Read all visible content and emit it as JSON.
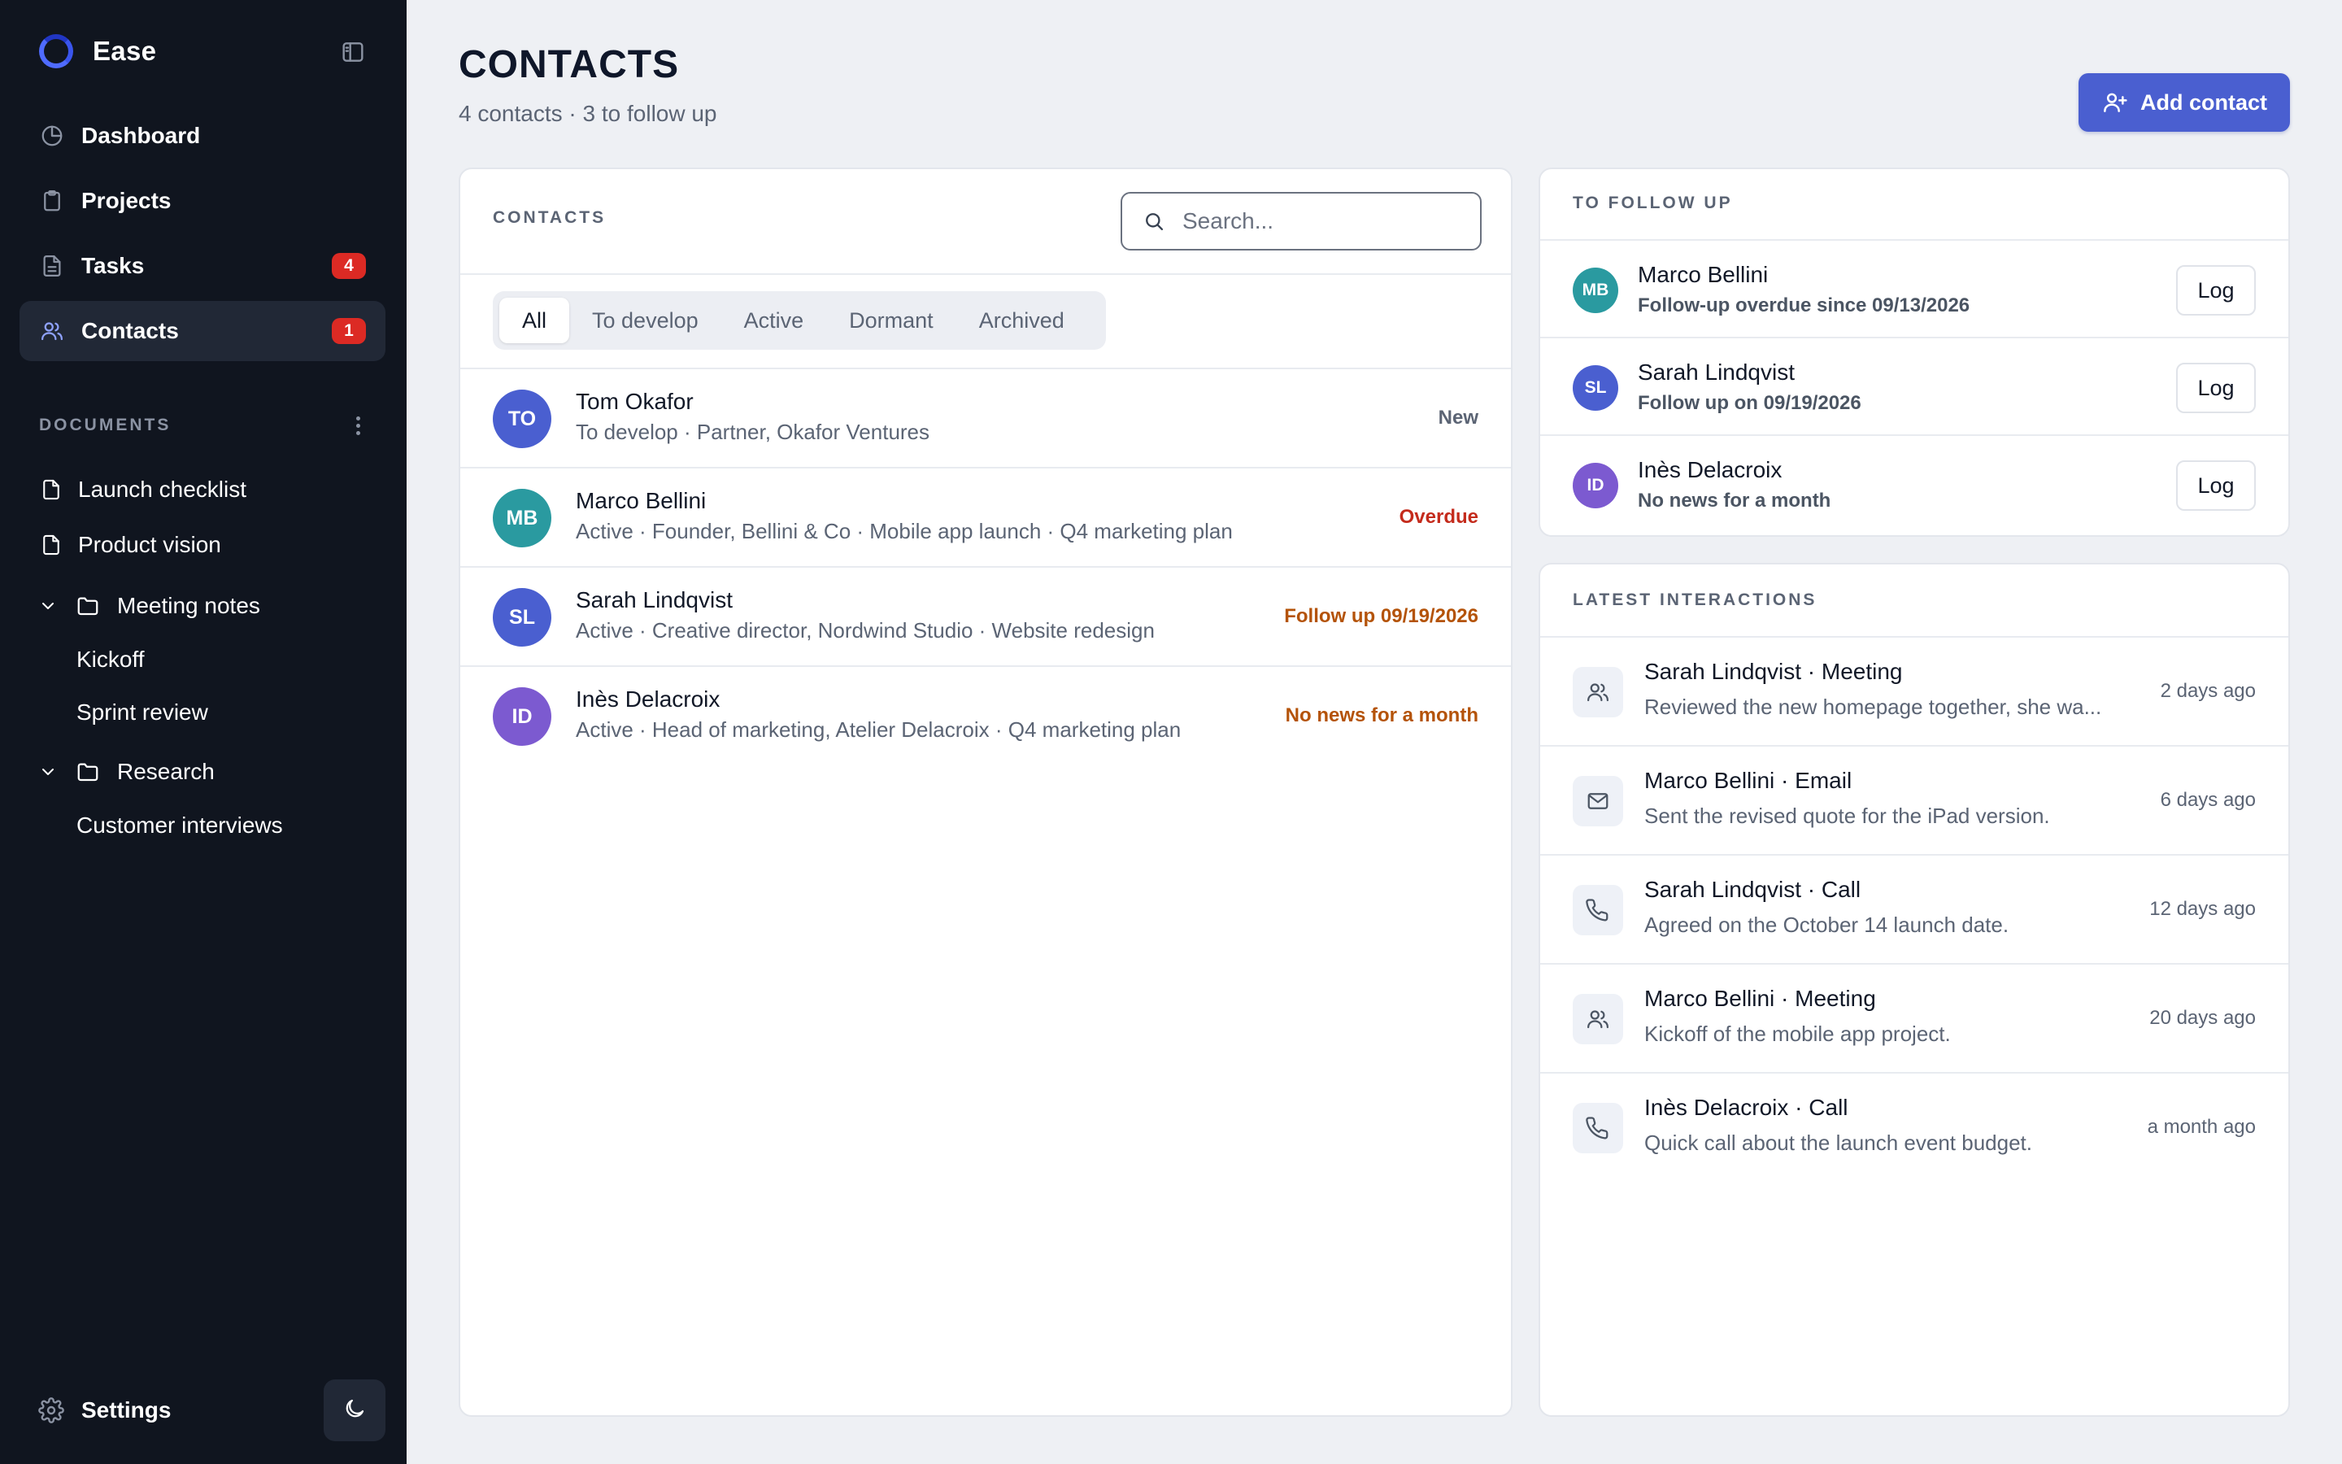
{
  "app": {
    "name": "Ease"
  },
  "colors": {
    "sidebar_bg": "#10151f",
    "accent": "#4a5fd0",
    "badge_red": "#dc2a24",
    "overdue": "#c42b1c",
    "warning": "#b45309"
  },
  "sidebar": {
    "nav": [
      {
        "label": "Dashboard",
        "icon": "pie-chart-icon"
      },
      {
        "label": "Projects",
        "icon": "clipboard-icon"
      },
      {
        "label": "Tasks",
        "icon": "file-text-icon",
        "badge": "4"
      },
      {
        "label": "Contacts",
        "icon": "users-icon",
        "badge": "1",
        "active": true
      }
    ],
    "documents_header": "DOCUMENTS",
    "documents": [
      {
        "label": "Launch checklist",
        "icon": "file-icon"
      },
      {
        "label": "Product vision",
        "icon": "file-icon"
      }
    ],
    "folders": [
      {
        "label": "Meeting notes",
        "children": [
          "Kickoff",
          "Sprint review"
        ]
      },
      {
        "label": "Research",
        "children": [
          "Customer interviews"
        ]
      }
    ],
    "settings_label": "Settings"
  },
  "header": {
    "title": "CONTACTS",
    "subtitle": "4 contacts · 3 to follow up",
    "add_button_label": "Add contact"
  },
  "contacts_panel": {
    "label": "CONTACTS",
    "search_placeholder": "Search...",
    "tabs": [
      "All",
      "To develop",
      "Active",
      "Dormant",
      "Archived"
    ],
    "active_tab": "All",
    "rows": [
      {
        "initials": "TO",
        "avatar_color": "#4a5fd0",
        "name": "Tom Okafor",
        "description": "To develop · Partner, Okafor Ventures",
        "status": "New",
        "status_color": "#5b6474"
      },
      {
        "initials": "MB",
        "avatar_color": "#2a9aa0",
        "name": "Marco Bellini",
        "description": "Active · Founder, Bellini & Co · Mobile app launch · Q4 marketing plan",
        "status": "Overdue",
        "status_color": "#c42b1c"
      },
      {
        "initials": "SL",
        "avatar_color": "#4a5fd0",
        "name": "Sarah Lindqvist",
        "description": "Active · Creative director, Nordwind Studio · Website redesign",
        "status": "Follow up 09/19/2026",
        "status_color": "#b45309"
      },
      {
        "initials": "ID",
        "avatar_color": "#7c5ad0",
        "name": "Inès Delacroix",
        "description": "Active · Head of marketing, Atelier Delacroix · Q4 marketing plan",
        "status": "No news for a month",
        "status_color": "#b45309"
      }
    ]
  },
  "follow_up": {
    "label": "TO FOLLOW UP",
    "log_label": "Log",
    "rows": [
      {
        "initials": "MB",
        "avatar_color": "#2a9aa0",
        "name": "Marco Bellini",
        "note": "Follow-up overdue since 09/13/2026"
      },
      {
        "initials": "SL",
        "avatar_color": "#4a5fd0",
        "name": "Sarah Lindqvist",
        "note": "Follow up on 09/19/2026"
      },
      {
        "initials": "ID",
        "avatar_color": "#7c5ad0",
        "name": "Inès Delacroix",
        "note": "No news for a month"
      }
    ]
  },
  "interactions": {
    "label": "LATEST INTERACTIONS",
    "rows": [
      {
        "icon": "meeting-icon",
        "title": "Sarah Lindqvist · Meeting",
        "text": "Reviewed the new homepage together, she wa...",
        "time": "2 days ago"
      },
      {
        "icon": "mail-icon",
        "title": "Marco Bellini · Email",
        "text": "Sent the revised quote for the iPad version.",
        "time": "6 days ago"
      },
      {
        "icon": "phone-icon",
        "title": "Sarah Lindqvist · Call",
        "text": "Agreed on the October 14 launch date.",
        "time": "12 days ago"
      },
      {
        "icon": "meeting-icon",
        "title": "Marco Bellini · Meeting",
        "text": "Kickoff of the mobile app project.",
        "time": "20 days ago"
      },
      {
        "icon": "phone-icon",
        "title": "Inès Delacroix · Call",
        "text": "Quick call about the launch event budget.",
        "time": "a month ago"
      }
    ]
  }
}
